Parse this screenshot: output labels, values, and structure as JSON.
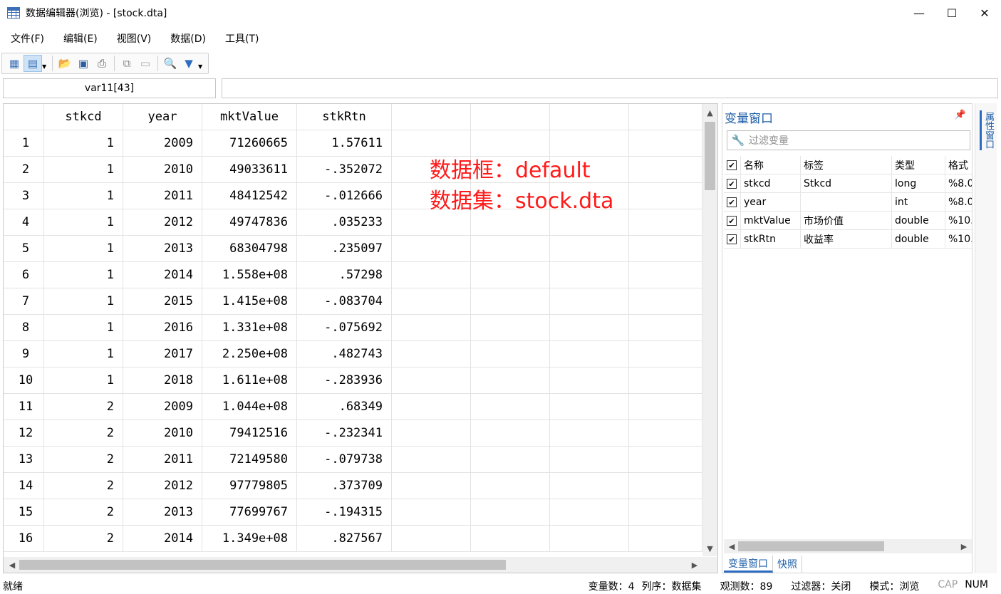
{
  "window": {
    "title": "数据编辑器(浏览) - [stock.dta]"
  },
  "menu": [
    "文件(F)",
    "编辑(E)",
    "视图(V)",
    "数据(D)",
    "工具(T)"
  ],
  "cellbar": {
    "name": "var11[43]",
    "value": ""
  },
  "grid": {
    "columns": [
      "stkcd",
      "year",
      "mktValue",
      "stkRtn"
    ],
    "rows": [
      [
        "1",
        "1",
        "2009",
        "71260665",
        "1.57611"
      ],
      [
        "2",
        "1",
        "2010",
        "49033611",
        "-.352072"
      ],
      [
        "3",
        "1",
        "2011",
        "48412542",
        "-.012666"
      ],
      [
        "4",
        "1",
        "2012",
        "49747836",
        ".035233"
      ],
      [
        "5",
        "1",
        "2013",
        "68304798",
        ".235097"
      ],
      [
        "6",
        "1",
        "2014",
        "1.558e+08",
        ".57298"
      ],
      [
        "7",
        "1",
        "2015",
        "1.415e+08",
        "-.083704"
      ],
      [
        "8",
        "1",
        "2016",
        "1.331e+08",
        "-.075692"
      ],
      [
        "9",
        "1",
        "2017",
        "2.250e+08",
        ".482743"
      ],
      [
        "10",
        "1",
        "2018",
        "1.611e+08",
        "-.283936"
      ],
      [
        "11",
        "2",
        "2009",
        "1.044e+08",
        ".68349"
      ],
      [
        "12",
        "2",
        "2010",
        "79412516",
        "-.232341"
      ],
      [
        "13",
        "2",
        "2011",
        "72149580",
        "-.079738"
      ],
      [
        "14",
        "2",
        "2012",
        "97779805",
        ".373709"
      ],
      [
        "15",
        "2",
        "2013",
        "77699767",
        "-.194315"
      ],
      [
        "16",
        "2",
        "2014",
        "1.349e+08",
        ".827567"
      ]
    ],
    "annotation": {
      "line1": "数据框：default",
      "line2": "数据集：stock.dta"
    }
  },
  "varpanel": {
    "title": "变量窗口",
    "filter_placeholder": "过滤变量",
    "headers": [
      "名称",
      "标签",
      "类型",
      "格式"
    ],
    "vars": [
      {
        "name": "stkcd",
        "label": "Stkcd",
        "type": "long",
        "format": "%8.0"
      },
      {
        "name": "year",
        "label": "",
        "type": "int",
        "format": "%8.0"
      },
      {
        "name": "mktValue",
        "label": "市场价值",
        "type": "double",
        "format": "%10."
      },
      {
        "name": "stkRtn",
        "label": "收益率",
        "type": "double",
        "format": "%10."
      }
    ],
    "tabs": [
      "变量窗口",
      "快照"
    ]
  },
  "side_tab": "属性窗口",
  "status": {
    "ready": "就绪",
    "varcount": "变量数：4",
    "order": "列序：数据集",
    "obs": "观测数：89",
    "filter": "过滤器：关闭",
    "mode": "模式：浏览",
    "cap": "CAP",
    "num": "NUM"
  },
  "colors": {
    "annotation": "#ff1a1a",
    "accent": "#1f5fa8"
  }
}
